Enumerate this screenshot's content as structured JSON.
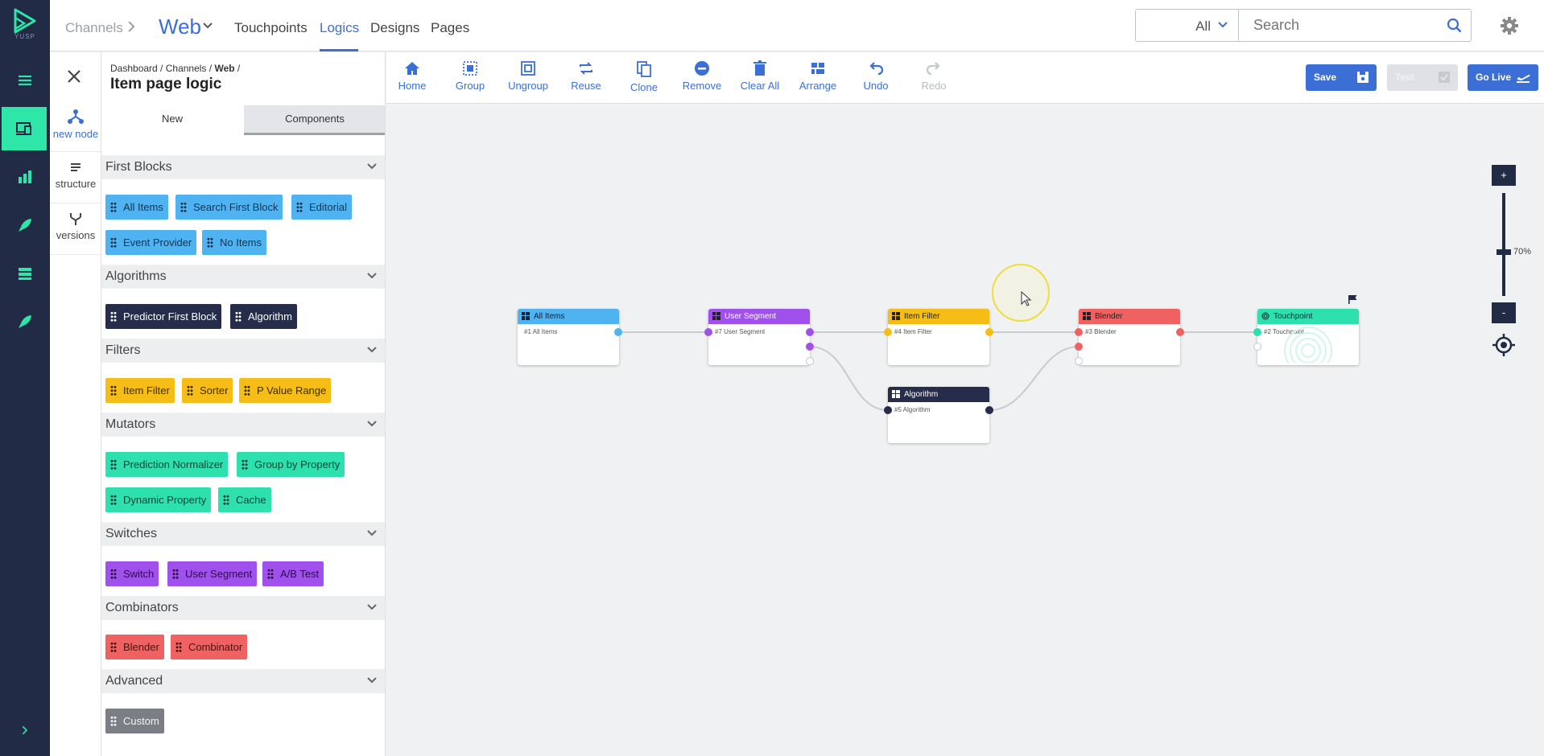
{
  "app": {
    "logo_text": "YUSP",
    "accent": "#2ee6a8",
    "primary": "#3b6fd6",
    "dark": "#222b45"
  },
  "rail": {
    "items": [
      "menu-icon",
      "devices-icon",
      "chart-icon",
      "rocket-icon",
      "list-icon",
      "rocket-icon"
    ]
  },
  "header": {
    "breadcrumb_root": "Channels",
    "channel": "Web",
    "tabs": [
      {
        "label": "Touchpoints"
      },
      {
        "label": "Logics"
      },
      {
        "label": "Designs"
      },
      {
        "label": "Pages"
      }
    ],
    "active_tab": "Logics",
    "search": {
      "filter": "All",
      "placeholder": "Search"
    }
  },
  "subrail": [
    {
      "label": "new node"
    },
    {
      "label": "structure"
    },
    {
      "label": "versions"
    }
  ],
  "panel": {
    "breadcrumb": {
      "dashboard": "Dashboard",
      "channels": "Channels",
      "web": "Web"
    },
    "title": "Item page logic",
    "tabs": {
      "new": "New",
      "components": "Components"
    },
    "sections": [
      {
        "title": "First Blocks",
        "items": [
          "All Items",
          "Search First Block",
          "Editorial",
          "Event Provider",
          "No Items"
        ]
      },
      {
        "title": "Algorithms",
        "items": [
          "Predictor First Block",
          "Algorithm"
        ]
      },
      {
        "title": "Filters",
        "items": [
          "Item Filter",
          "Sorter",
          "P Value Range"
        ]
      },
      {
        "title": "Mutators",
        "items": [
          "Prediction Normalizer",
          "Group by Property",
          "Dynamic Property",
          "Cache"
        ]
      },
      {
        "title": "Switches",
        "items": [
          "Switch",
          "User Segment",
          "A/B Test"
        ]
      },
      {
        "title": "Combinators",
        "items": [
          "Blender",
          "Combinator"
        ]
      },
      {
        "title": "Advanced",
        "items": [
          "Custom"
        ]
      }
    ]
  },
  "toolbar": {
    "tools": [
      {
        "label": "Home"
      },
      {
        "label": "Group"
      },
      {
        "label": "Ungroup"
      },
      {
        "label": "Reuse"
      },
      {
        "label": "Clone"
      },
      {
        "label": "Remove"
      },
      {
        "label": "Clear All"
      },
      {
        "label": "Arrange"
      },
      {
        "label": "Undo"
      },
      {
        "label": "Redo"
      }
    ],
    "save": "Save",
    "test": "Test",
    "go_live": "Go Live"
  },
  "canvas": {
    "nodes": [
      {
        "title": "All Items",
        "id_label": "#1 All Items",
        "color": "#4fb3f2"
      },
      {
        "title": "User Segment",
        "id_label": "#7 User Segment",
        "color": "#a050eb"
      },
      {
        "title": "Item Filter",
        "id_label": "#4 Item Filter",
        "color": "#f6bd16"
      },
      {
        "title": "Algorithm",
        "id_label": "#5 Algorithm",
        "color": "#252d4a"
      },
      {
        "title": "Blender",
        "id_label": "#3 Blender",
        "color": "#f06262"
      },
      {
        "title": "Touchpoint",
        "id_label": "#2 Touchpoint",
        "color": "#2ee0ae"
      }
    ],
    "zoom": {
      "in": "+",
      "out": "-",
      "level": "70%"
    }
  }
}
